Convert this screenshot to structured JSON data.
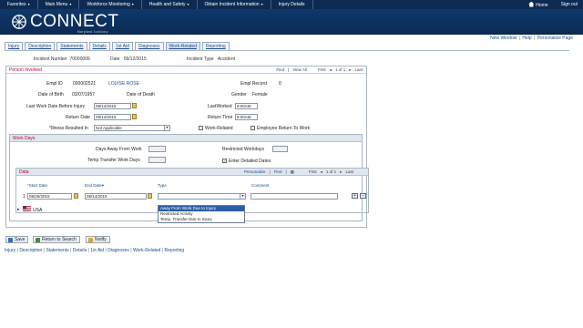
{
  "topnav": {
    "items": [
      "Favorites",
      "Main Menu",
      "Workforce Monitoring",
      "Health and Safety",
      "Obtain Incident Information",
      "Injury Details"
    ],
    "home": "Home",
    "signout": "Sign out"
  },
  "brand": {
    "name": "CONNECT",
    "subtitle": "Maryland Judiciary"
  },
  "top_links": {
    "new_window": "New Window",
    "help": "Help",
    "personalize": "Personalize Page"
  },
  "tabs": [
    "Injury",
    "Description",
    "Statements",
    "Details",
    "1st Aid",
    "Diagnoses",
    "Work-Related",
    "Reporting"
  ],
  "active_tab": "Work-Related",
  "header": {
    "incident_label": "Incident Number",
    "incident_value": "70000009",
    "date_label": "Date",
    "date_value": "09/12/2015",
    "type_label": "Incident Type",
    "type_value": "Accident"
  },
  "person": {
    "title": "Person Involved",
    "nav_find": "Find",
    "nav_viewall": "View All",
    "nav_first": "First",
    "nav_count": "1 of 1",
    "nav_last": "Last",
    "emplid_label": "Empl ID",
    "emplid_value": "000002521",
    "name_value": "LOUISE ROSE",
    "emplrec_label": "Empl Record",
    "emplrec_value": "0",
    "dob_label": "Date of Birth",
    "dob_value": "03/07/1957",
    "dod_label": "Date of Death",
    "gender_label": "Gender",
    "gender_value": "Female",
    "lastwork_label": "Last Work Date Before Injury",
    "lastwork_value": "09/14/2015",
    "lastworked_label": "LastWorked",
    "lastworked_value": "8:00AM",
    "returndate_label": "Return Date",
    "returndate_value": "09/14/2015",
    "returntime_label": "Return Time",
    "returntime_value": "8:00AM",
    "illness_label": "*Illness Resulted In",
    "illness_value": "Not Applicable",
    "workrelated_label": "Work-Related",
    "returntowork_label": "Employee Return To Work"
  },
  "workdays": {
    "title": "Work Days",
    "away_label": "Days Away From Work",
    "restricted_label": "Restricted Workdays",
    "temp_label": "Temp Transfer Work Days",
    "detailed_label": "Enter Detailed Dates",
    "detailed_checked": true
  },
  "data_grid": {
    "title": "Data",
    "nav_personalize": "Personalize",
    "nav_find": "Find",
    "nav_first": "First",
    "nav_count": "1 of 1",
    "nav_last": "Last",
    "col_start": "*Start Date",
    "col_end": "End Date",
    "col_type": "Type",
    "col_comment": "Comment",
    "row_num": "1",
    "start_value": "09/26/2015",
    "end_value": "09/14/2015",
    "type_options": [
      "Away From Work Due to Injury",
      "Restricted Activity",
      "Temp. Transfer Due to Injury"
    ],
    "highlighted_option": "Away From Work Due to Injury",
    "country": "USA"
  },
  "buttons": {
    "save": "Save",
    "return": "Return to Search",
    "notify": "Notify"
  },
  "footer_links": [
    "Injury",
    "Description",
    "Statements",
    "Details",
    "1st Aid",
    "Diagnoses",
    "Work-Related",
    "Reporting"
  ],
  "colors": {
    "nav_bg": "#0d2a52",
    "accent_red": "#cc0033",
    "link": "#1a4c8a"
  }
}
